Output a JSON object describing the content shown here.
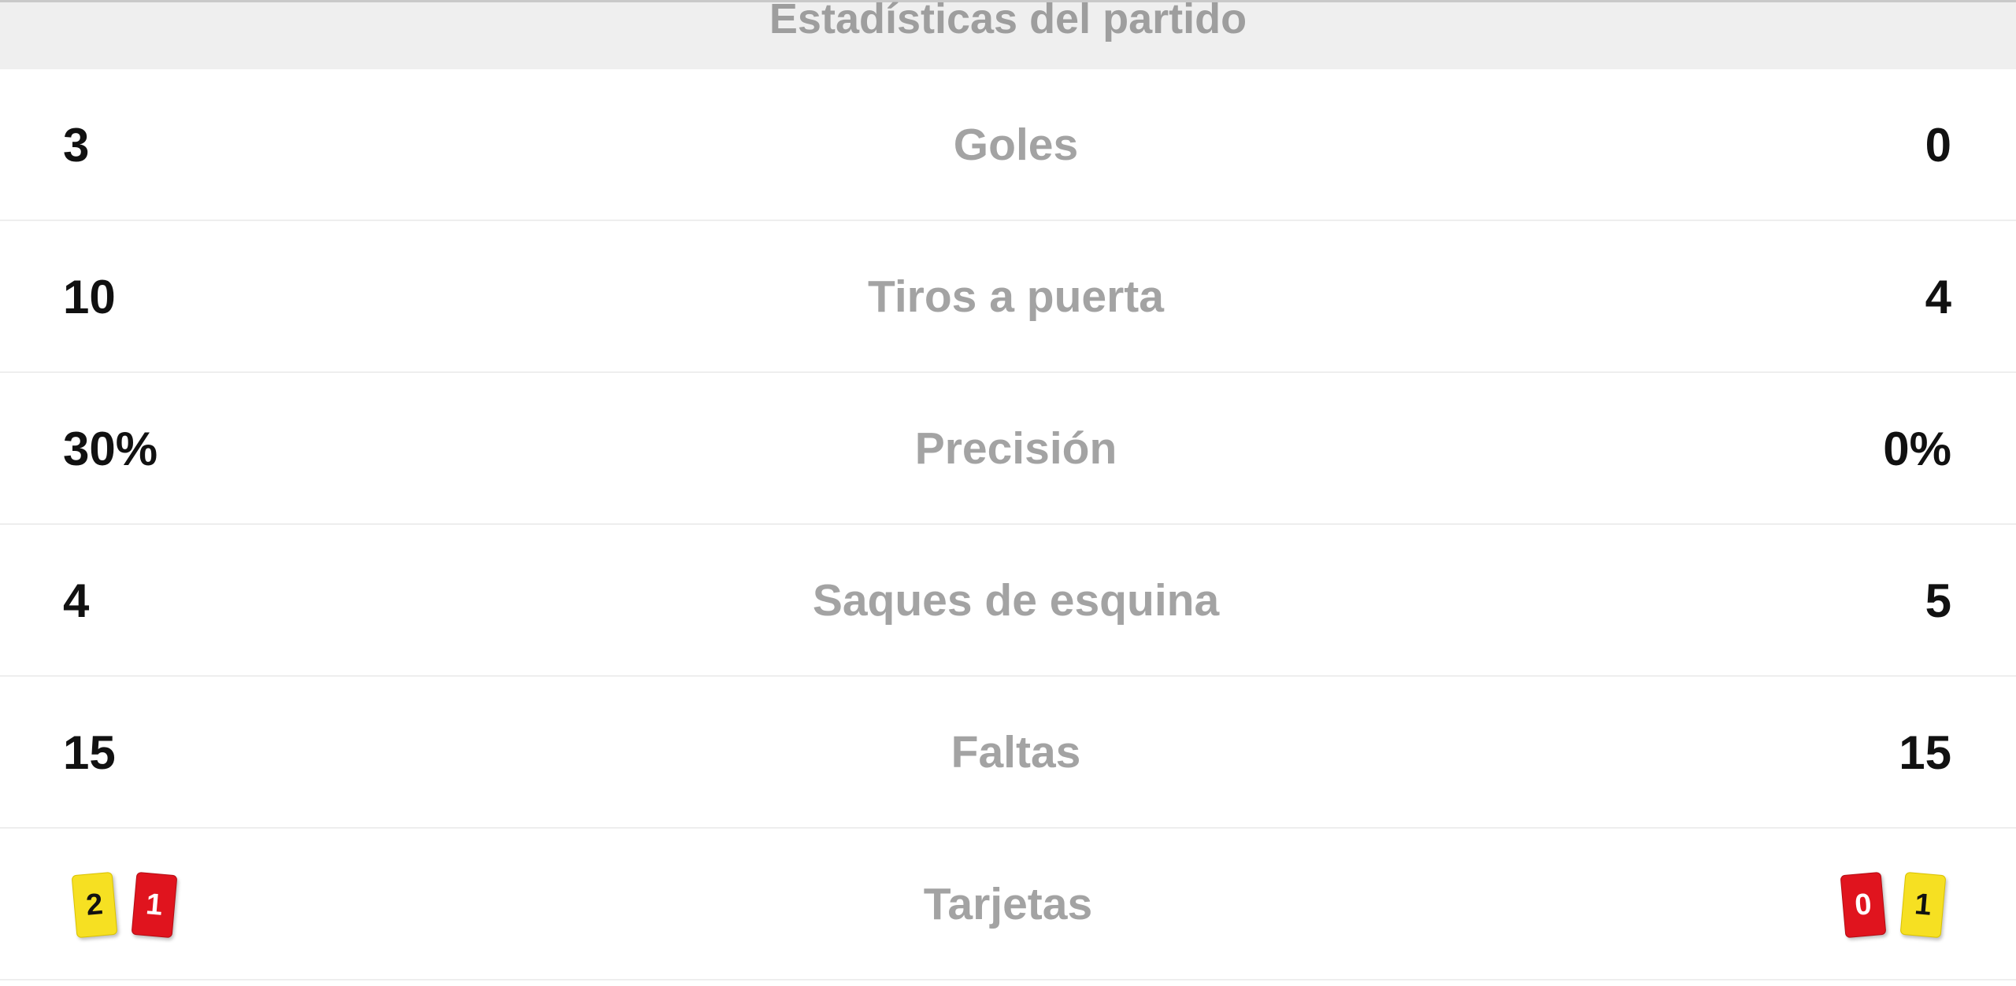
{
  "header": {
    "title": "Estadísticas del partido"
  },
  "stats": [
    {
      "label": "Goles",
      "home": "3",
      "away": "0"
    },
    {
      "label": "Tiros a puerta",
      "home": "10",
      "away": "4"
    },
    {
      "label": "Precisión",
      "home": "30%",
      "away": "0%"
    },
    {
      "label": "Saques de esquina",
      "home": "4",
      "away": "5"
    },
    {
      "label": "Faltas",
      "home": "15",
      "away": "15"
    }
  ],
  "cards": {
    "label": "Tarjetas",
    "home": {
      "yellow": "2",
      "red": "1"
    },
    "away": {
      "red": "0",
      "yellow": "1"
    }
  },
  "colors": {
    "yellow_card": "#f6e022",
    "red_card": "#e0141e",
    "label": "#a3a3a3"
  }
}
